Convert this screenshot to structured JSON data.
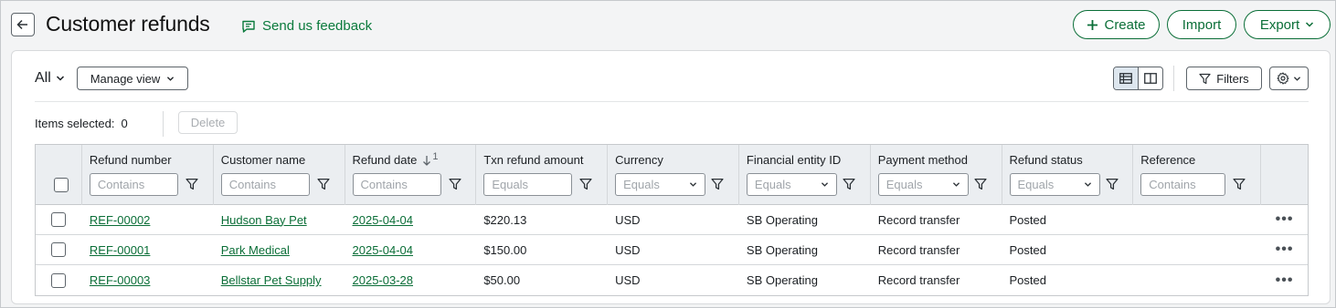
{
  "header": {
    "title": "Customer refunds",
    "feedback_label": "Send us feedback",
    "create_label": "Create",
    "import_label": "Import",
    "export_label": "Export"
  },
  "toolbar": {
    "view_label": "All",
    "manage_view_label": "Manage view",
    "filters_label": "Filters",
    "items_selected_label": "Items selected:",
    "items_selected_count": "0",
    "delete_label": "Delete"
  },
  "table": {
    "columns": [
      {
        "label": "Refund number",
        "placeholder": "Contains",
        "type": "text"
      },
      {
        "label": "Customer name",
        "placeholder": "Contains",
        "type": "text"
      },
      {
        "label": "Refund date",
        "placeholder": "Contains",
        "type": "text",
        "sort": "1"
      },
      {
        "label": "Txn refund amount",
        "placeholder": "Equals",
        "type": "text"
      },
      {
        "label": "Currency",
        "placeholder": "Equals",
        "type": "select"
      },
      {
        "label": "Financial entity ID",
        "placeholder": "Equals",
        "type": "select"
      },
      {
        "label": "Payment method",
        "placeholder": "Equals",
        "type": "select"
      },
      {
        "label": "Refund status",
        "placeholder": "Equals",
        "type": "select"
      },
      {
        "label": "Reference",
        "placeholder": "Contains",
        "type": "text"
      }
    ],
    "rows": [
      {
        "refund_number": "REF-00002",
        "customer": "Hudson Bay Pet",
        "date": "2025-04-04",
        "amount": "$220.13",
        "currency": "USD",
        "entity": "SB Operating",
        "method": "Record transfer",
        "status": "Posted",
        "reference": ""
      },
      {
        "refund_number": "REF-00001",
        "customer": "Park Medical",
        "date": "2025-04-04",
        "amount": "$150.00",
        "currency": "USD",
        "entity": "SB Operating",
        "method": "Record transfer",
        "status": "Posted",
        "reference": ""
      },
      {
        "refund_number": "REF-00003",
        "customer": "Bellstar Pet Supply",
        "date": "2025-03-28",
        "amount": "$50.00",
        "currency": "USD",
        "entity": "SB Operating",
        "method": "Record transfer",
        "status": "Posted",
        "reference": ""
      }
    ]
  },
  "colors": {
    "accent": "#0a6e37",
    "header_bg": "#ebeef1",
    "page_bg": "#f3f4f5"
  }
}
